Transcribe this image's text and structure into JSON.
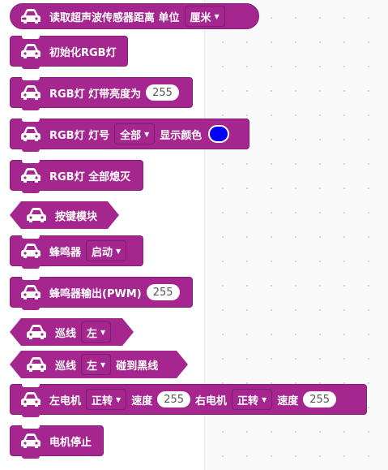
{
  "colors": {
    "block": "#a5268f",
    "block_border": "#831f72",
    "led_color": "#0000ff"
  },
  "icon": "car-icon",
  "blocks": {
    "ultrasonic": {
      "label": "读取超声波传感器距离 单位",
      "unit": "厘米"
    },
    "rgb_init": {
      "label": "初始化RGB灯"
    },
    "rgb_brightness": {
      "label": "RGB灯 灯带亮度为",
      "value": "255"
    },
    "rgb_set": {
      "label": "RGB灯 灯号",
      "led": "全部",
      "label2": "显示颜色"
    },
    "rgb_off": {
      "label": "RGB灯 全部熄灭"
    },
    "button": {
      "label": "按键模块"
    },
    "buzzer": {
      "label": "蜂鸣器",
      "state": "启动"
    },
    "buzzer_pwm": {
      "label": "蜂鸣器输出(PWM)",
      "value": "255"
    },
    "line1": {
      "label": "巡线",
      "side": "左"
    },
    "line2": {
      "label": "巡线",
      "side": "左",
      "label2": "碰到黑线"
    },
    "motors": {
      "left_label": "左电机",
      "left_dir": "正转",
      "speed_label": "速度",
      "left_speed": "255",
      "right_label": "右电机",
      "right_dir": "正转",
      "right_speed": "255"
    },
    "stop": {
      "label": "电机停止"
    }
  }
}
